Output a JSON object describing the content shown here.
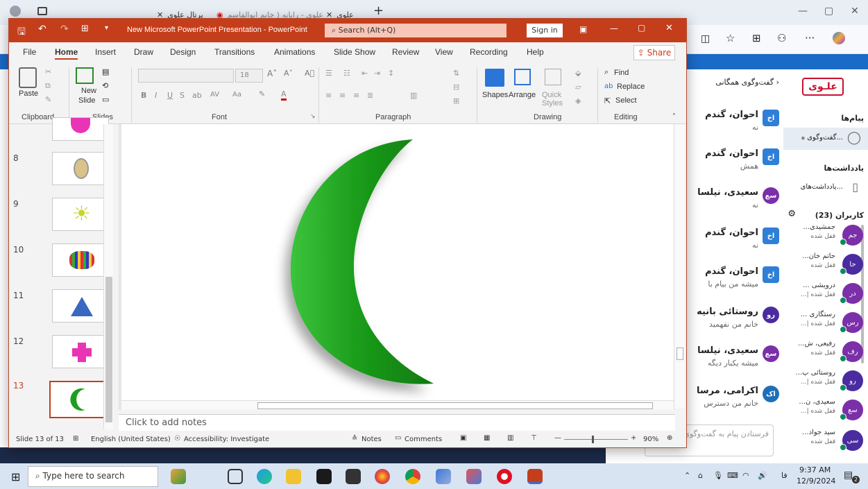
{
  "browser": {
    "tabs": [
      {
        "label": "پرتال علوی"
      },
      {
        "label": "علوی - رایانه ( خانم ابوالقاسم"
      },
      {
        "label": "علوی"
      }
    ],
    "new_tab": "+"
  },
  "ppt": {
    "title": "New Microsoft PowerPoint Presentation - PowerPoint",
    "search_placeholder": "Search (Alt+Q)",
    "sign_in": "Sign in",
    "menu": [
      "File",
      "Home",
      "Insert",
      "Draw",
      "Design",
      "Transitions",
      "Animations",
      "Slide Show",
      "Review",
      "View",
      "Recording",
      "Help"
    ],
    "share": "Share",
    "groups": {
      "clipboard": "Clipboard",
      "slides": "Slides",
      "font": "Font",
      "paragraph": "Paragraph",
      "drawing": "Drawing",
      "editing": "Editing"
    },
    "ribbon": {
      "paste": "Paste",
      "new_slide": "New",
      "new_slide2": "Slide",
      "font_size": "18",
      "shapes": "Shapes",
      "arrange": "Arrange",
      "quick_styles": "Quick",
      "quick_styles2": "Styles",
      "find": "Find",
      "replace": "Replace",
      "select": "Select"
    },
    "slide_numbers": [
      "8",
      "9",
      "10",
      "11",
      "12",
      "13"
    ],
    "notes_placeholder": "Click to add notes",
    "status": {
      "slide": "Slide 13 of 13",
      "language": "English (United States)",
      "accessibility": "Accessibility: Investigate",
      "notes": "Notes",
      "comments": "Comments",
      "zoom": "90%"
    }
  },
  "lms": {
    "logo": "علـوی",
    "back_label": "گفت‌وگوی همگانی",
    "side": {
      "messages": "پیام‌ها",
      "public_chat": "گفت‌وگوی ه...",
      "notes": "یادداشت‌ها",
      "notes_item": "یادداشت‌های...",
      "users": "کاربران (23)"
    },
    "messages": [
      {
        "avatar": "اخ",
        "name": "احوان، گندم",
        "text": "نه",
        "color": "#2f7fd6"
      },
      {
        "avatar": "اخ",
        "name": "احوان، گندم",
        "text": "همش",
        "color": "#2f7fd6"
      },
      {
        "avatar": "سع",
        "name": "سعیدی، نیلسا",
        "text": "نه",
        "color": "#7b2fa8"
      },
      {
        "avatar": "اخ",
        "name": "احوان، گندم",
        "text": "نه",
        "color": "#2f7fd6"
      },
      {
        "avatar": "اخ",
        "name": "احوان، گندم",
        "text": "میشه من بیام با",
        "color": "#2f7fd6"
      },
      {
        "avatar": "رو",
        "name": "روستائی بانیه",
        "text": "خانم من نفهمید",
        "color": "#4a2ca0"
      },
      {
        "avatar": "سع",
        "name": "سعیدی، نیلسا",
        "text": "میشه یکبار دیگه",
        "color": "#7b2fa8"
      },
      {
        "avatar": "اک",
        "name": "اکرامی، مرسا",
        "text": "خانم من دسترس",
        "color": "#1f6fb8"
      }
    ],
    "message_placeholder": "فرستادن پیام به گفت‌وگوی همگانی",
    "users": [
      {
        "avatar": "جم",
        "name": "جمشیدی...",
        "status": "قفل شده",
        "color": "#7b2fa8"
      },
      {
        "avatar": "حا",
        "name": "حاتم خان...",
        "status": "قفل شده",
        "color": "#4a2ca0"
      },
      {
        "avatar": "در",
        "name": "درویشی ...",
        "status": "قفل شده |...",
        "color": "#7b2fa8"
      },
      {
        "avatar": "رس",
        "name": "رستگاری ...",
        "status": "قفل شده |...",
        "color": "#7b2fa8"
      },
      {
        "avatar": "رف",
        "name": "رفیعی، ش...",
        "status": "قفل شده",
        "color": "#7b2fa8"
      },
      {
        "avatar": "رو",
        "name": "روستائی پ...",
        "status": "قفل شده |...",
        "color": "#4a2ca0"
      },
      {
        "avatar": "سع",
        "name": "سعیدی، ن...",
        "status": "قفل شده |...",
        "color": "#7b2fa8"
      },
      {
        "avatar": "سی",
        "name": "سید جواد...",
        "status": "قفل شده",
        "color": "#4a2ca0"
      }
    ]
  },
  "taskbar": {
    "search_placeholder": "Type here to search",
    "time": "9:37 AM",
    "date": "12/9/2024",
    "lang": "فا",
    "notification_count": "2"
  },
  "colors": {
    "ppt_accent": "#c43e1c",
    "moon_green": "#1e9e1e",
    "lms_blue": "#1a6ac7"
  }
}
